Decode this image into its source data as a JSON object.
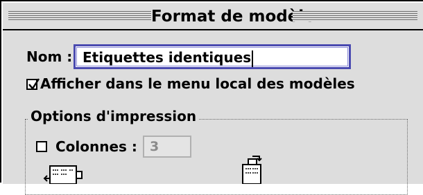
{
  "window": {
    "title": "Format de modèle"
  },
  "form": {
    "name_label": "Nom :",
    "name_value": "Etiquettes identiques",
    "show_in_menu_label": "Afficher dans le menu local des modèles",
    "show_in_menu_checked": true
  },
  "print_options": {
    "group_label": "Options d'impression",
    "columns_label": "Colonnes :",
    "columns_checked": false,
    "columns_value": "3",
    "icons": [
      "landscape-layout-icon",
      "portrait-layout-icon"
    ]
  }
}
